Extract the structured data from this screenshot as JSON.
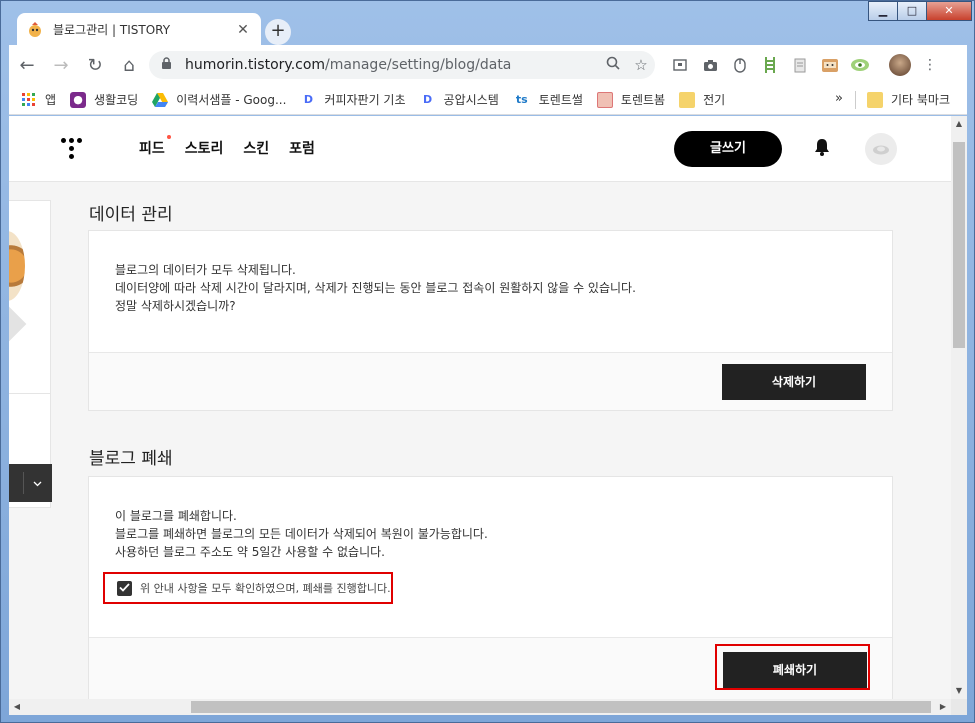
{
  "browser": {
    "tab_title": "블로그관리 | TISTORY",
    "new_tab": "+",
    "url_host": "humorin.tistory.com",
    "url_path": "/manage/setting/blog/data",
    "window_controls": {
      "minimize": "▁",
      "maximize": "□",
      "close": "✕"
    },
    "nav": {
      "back": "←",
      "forward": "→",
      "reload": "↻",
      "home": "⌂"
    }
  },
  "bookmarks": [
    {
      "label": "앱",
      "icon": "apps-icon",
      "color": "#e94235"
    },
    {
      "label": "생활코딩",
      "icon": "saenghwal-icon",
      "color": "#7b2a8b"
    },
    {
      "label": "이력서샘플 - Goog...",
      "icon": "drive-icon",
      "color": "#1fa463"
    },
    {
      "label": "커피자판기 기초",
      "icon": "d-icon",
      "color": "#4a6cf7"
    },
    {
      "label": "공압시스템",
      "icon": "d-icon",
      "color": "#4a6cf7"
    },
    {
      "label": "토렌트썰",
      "icon": "ts-icon",
      "color": "#1f7ac8"
    },
    {
      "label": "토렌트봄",
      "icon": "torrent-icon",
      "color": "#e37b6b"
    },
    {
      "label": "전기",
      "icon": "folder-icon",
      "color": "#f5c842"
    }
  ],
  "bookmarks_more": "»",
  "bookmarks_other": "기타 북마크",
  "site": {
    "nav": [
      "피드",
      "스토리",
      "스킨",
      "포럼"
    ],
    "write_button": "글쓰기"
  },
  "data_section": {
    "title": "데이터 관리",
    "lines": [
      "블로그의 데이터가 모두 삭제됩니다.",
      "데이터양에 따라 삭제 시간이 달라지며, 삭제가 진행되는 동안 블로그 접속이 원활하지 않을 수 있습니다.",
      "정말 삭제하시겠습니까?"
    ],
    "button": "삭제하기"
  },
  "close_section": {
    "title": "블로그 폐쇄",
    "lines": [
      "이 블로그를 폐쇄합니다.",
      "블로그를 폐쇄하면 블로그의 모든 데이터가 삭제되어 복원이 불가능합니다.",
      "사용하던 블로그 주소도 약 5일간 사용할 수 없습니다."
    ],
    "agree_label": "위 안내 사항을 모두 확인하였으며, 폐쇄를 진행합니다.",
    "agree_checked": true,
    "button": "폐쇄하기"
  },
  "colors": {
    "highlight": "#e00000",
    "dark_button": "#222222",
    "write_button": "#000000"
  }
}
